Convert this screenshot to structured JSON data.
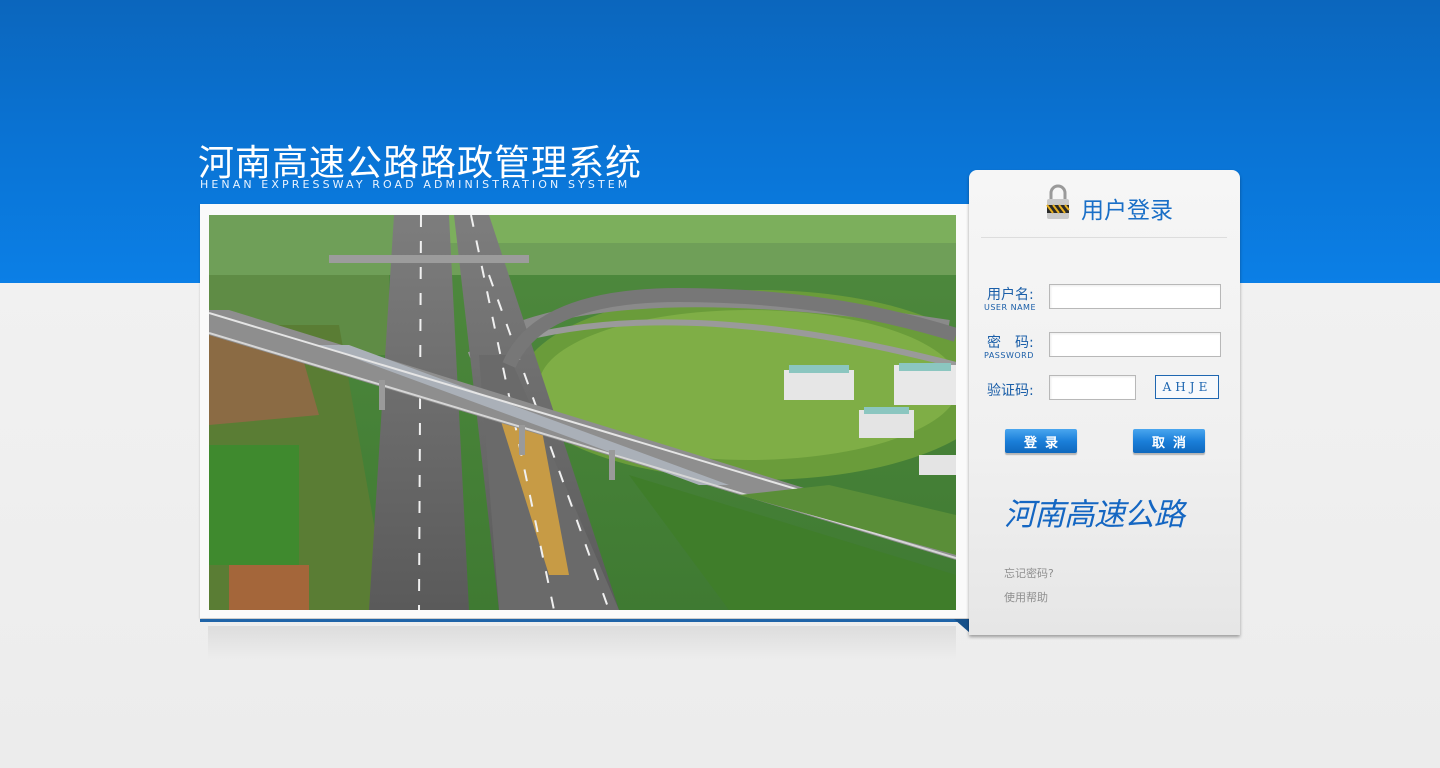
{
  "header": {
    "title_cn": "河南高速公路路政管理系统",
    "title_en": "Henan expressway road administration system"
  },
  "banner": {
    "icon": "highway-interchange-photo"
  },
  "login": {
    "title": "用户登录",
    "username_label_cn": "用户名:",
    "username_label_en": "User name",
    "username_value": "",
    "password_label_cn": "密　码:",
    "password_label_en": "Password",
    "password_value": "",
    "captcha_label": "验证码:",
    "captcha_value": "",
    "captcha_code": "AHJE",
    "login_button": "登录",
    "cancel_button": "取消",
    "signature_text": "河南高速公路",
    "forgot_password_link": "忘记密码?",
    "help_link": "使用帮助"
  },
  "colors": {
    "header_blue": "#0a72d2",
    "accent_blue": "#1a6fc7",
    "button_blue": "#1b7fd9",
    "page_gray": "#eeeeee"
  }
}
